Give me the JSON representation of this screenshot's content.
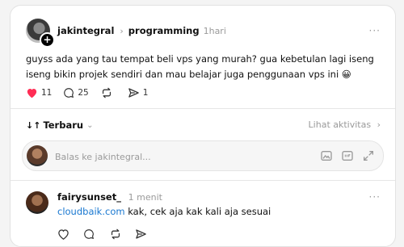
{
  "post": {
    "username": "jakintegral",
    "community": "programming",
    "time": "1hari",
    "text": "guyss ada yang tau tempat beli vps yang murah? gua kebetulan lagi iseng iseng bikin projek sendiri dan mau belajar juga penggunaan vps ini 😀",
    "likes": "11",
    "comments": "25",
    "shares": "1",
    "more": "···"
  },
  "sort": {
    "label": "Terbaru",
    "activity": "Lihat aktivitas"
  },
  "reply": {
    "placeholder": "Balas ke jakintegral..."
  },
  "comment": {
    "username": "fairysunset_",
    "time": "1 menit",
    "link": "cloudbaik.com",
    "text": " kak, cek aja kak kali aja sesuai",
    "more": "···"
  },
  "colors": {
    "like_red": "#ff2d55",
    "link_blue": "#1877d0"
  }
}
